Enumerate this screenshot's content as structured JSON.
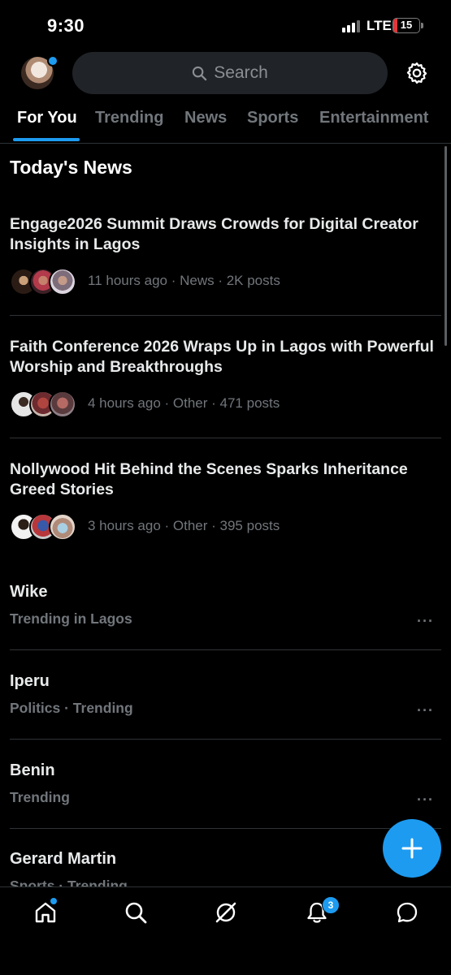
{
  "status_bar": {
    "time": "9:30",
    "network": "LTE",
    "battery": "15"
  },
  "header": {
    "search_placeholder": "Search"
  },
  "tabs": [
    {
      "label": "For You",
      "active": true
    },
    {
      "label": "Trending",
      "active": false
    },
    {
      "label": "News",
      "active": false
    },
    {
      "label": "Sports",
      "active": false
    },
    {
      "label": "Entertainment",
      "active": false
    }
  ],
  "section_title": "Today's News",
  "news": [
    {
      "headline": "Engage2026 Summit Draws Crowds for Digital Creator Insights in Lagos",
      "meta": "11 hours ago · News · 2K posts"
    },
    {
      "headline": "Faith Conference 2026 Wraps Up in Lagos with Powerful Worship and Breakthroughs",
      "meta": "4 hours ago · Other · 471 posts"
    },
    {
      "headline": "Nollywood Hit Behind the Scenes Sparks Inheritance Greed Stories",
      "meta": "3 hours ago · Other · 395 posts"
    }
  ],
  "trends": [
    {
      "name": "Wike",
      "context": "Trending in Lagos"
    },
    {
      "name": "Iperu",
      "context": "Politics · Trending"
    },
    {
      "name": "Benin",
      "context": "Trending"
    },
    {
      "name": "Gerard Martin",
      "context": "Sports · Trending"
    }
  ],
  "more_glyph": "···",
  "bottom_nav": {
    "notifications_badge": "3"
  },
  "colors": {
    "accent": "#1d9bf0",
    "background": "#000000",
    "muted": "#71767b"
  }
}
